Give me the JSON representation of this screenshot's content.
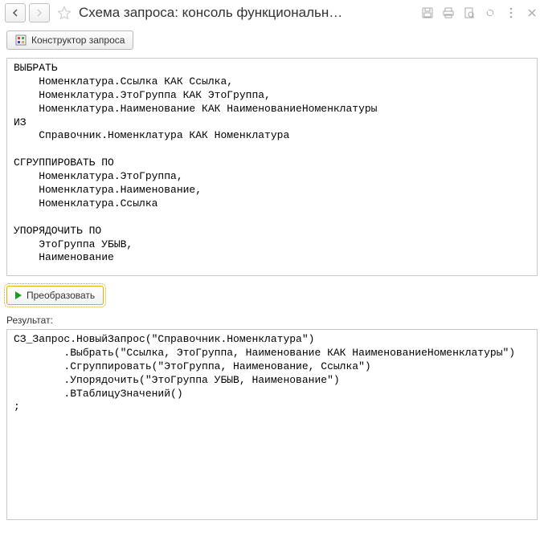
{
  "titlebar": {
    "title": "Схема запроса: консоль функциональн…"
  },
  "toolbar": {
    "constructor_label": "Конструктор запроса"
  },
  "query_text": "ВЫБРАТЬ\n    Номенклатура.Ссылка КАК Ссылка,\n    Номенклатура.ЭтоГруппа КАК ЭтоГруппа,\n    Номенклатура.Наименование КАК НаименованиеНоменклатуры\nИЗ\n    Справочник.Номенклатура КАК Номенклатура\n\nСГРУППИРОВАТЬ ПО\n    Номенклатура.ЭтоГруппа,\n    Номенклатура.Наименование,\n    Номенклатура.Ссылка\n\nУПОРЯДОЧИТЬ ПО\n    ЭтоГруппа УБЫВ,\n    Наименование",
  "transform": {
    "label": "Преобразовать"
  },
  "result": {
    "label": "Результат:",
    "text": "СЗ_Запрос.НовыйЗапрос(\"Справочник.Номенклатура\")\n        .Выбрать(\"Ссылка, ЭтоГруппа, Наименование КАК НаименованиеНоменклатуры\")\n        .Сгруппировать(\"ЭтоГруппа, Наименование, Ссылка\")\n        .Упорядочить(\"ЭтоГруппа УБЫВ, Наименование\")\n        .ВТаблицуЗначений()\n;"
  }
}
